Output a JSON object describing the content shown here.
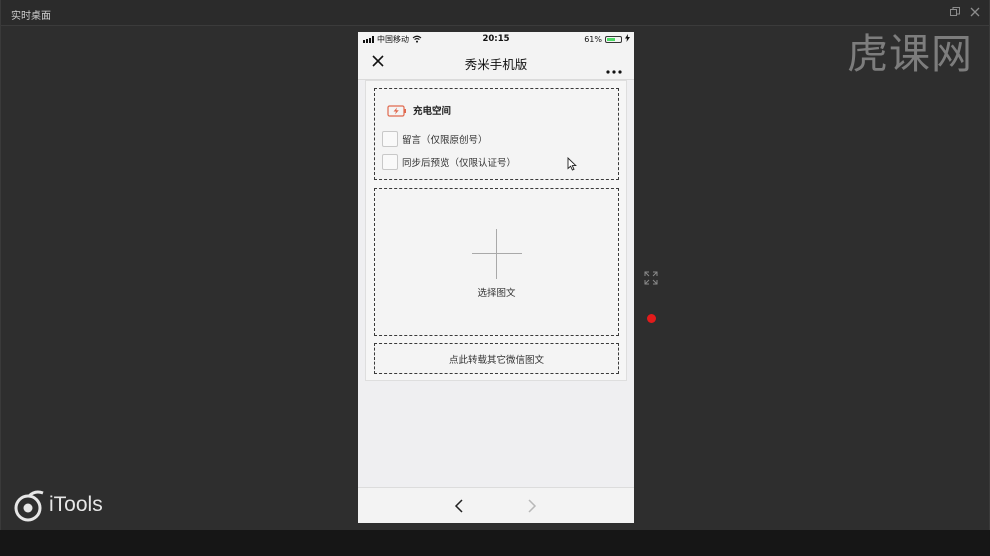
{
  "window": {
    "title": "实时桌面",
    "brand": "虎课网",
    "logo_text": "iTools"
  },
  "phone": {
    "status": {
      "carrier": "中国移动",
      "time": "20:15",
      "battery": "61%",
      "battery_level": 0.61
    },
    "nav": {
      "title": "秀米手机版"
    },
    "panel": {
      "charge_label": "充电空间",
      "options": [
        {
          "label": "留言（仅限原创号）",
          "checked": false
        },
        {
          "label": "同步后预览（仅限认证号）",
          "checked": false
        }
      ],
      "select_label": "选择图文",
      "transfer_label": "点此转载其它微信图文"
    }
  },
  "icons": [
    "close-icon",
    "more-icon",
    "charge-icon",
    "plus-icon",
    "back-icon",
    "forward-icon",
    "expand-icon",
    "wifi-icon",
    "cursor-icon"
  ],
  "colors": {
    "record_dot": "#e21b1b",
    "charge_icon": "#e0694e",
    "battery_fill": "#4cd964"
  }
}
